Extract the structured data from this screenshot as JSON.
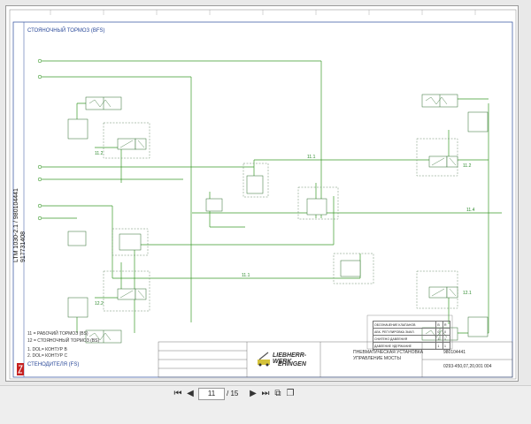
{
  "page_nav": {
    "current": "11",
    "separator": "/",
    "total": "15"
  },
  "sections": {
    "top": "СТОЯНОЧНЫЙ ТОРМОЗ (BFS)",
    "bottom": "СТЕНОДИТЕЛЯ (FS)"
  },
  "side_strip": {
    "model": "LTM 1030-2.1",
    "serial": "917731408",
    "doc": "980104441"
  },
  "notes": {
    "n1": "11 = РАБОЧИЙ ТОРМОЗ (BS)",
    "n2": "12 = СТОЯНОЧНЫЙ ТОРМОЗ (BS)",
    "n3": "1. DOL= КОНТУР В",
    "n4": "2. DOL= КОНТУР С"
  },
  "legend_table": {
    "rows": [
      {
        "label": "ОБОЗНАЧЕНИЕ КЛАПАНОВ",
        "a": "B",
        "b": "R"
      },
      {
        "label": "АБК- РЕГУЛИРОВКА ЗЫКЛ.",
        "a": "0",
        "b": "0"
      },
      {
        "label": "СНИГЕНО ДАВЛЕНИЯ",
        "a": "1",
        "b": "1"
      },
      {
        "label": "ДАВЛЕНИЕ УДЕРЖАНИЕ",
        "a": "1",
        "b": "1"
      }
    ]
  },
  "title_block": {
    "brand_top": "LIEBHERR-WERK",
    "brand_bottom": "EHINGEN",
    "title1": "ПНЕВМАТИЧЕСКАЯ УСТАНОВКА",
    "title2": "УПРАВЛЕНИЕ МОСТЫ",
    "doc_no": "980104441",
    "ref": "0293-450,07,20,001 004"
  },
  "line_labels": {
    "l1": "11.2",
    "l2": "12.2",
    "l3": "11.2",
    "l4": "12.1",
    "l5": "11.1",
    "l6": "11.4",
    "l7": "11.1"
  },
  "colors": {
    "line": "#3a9a2a",
    "dash": "#6a8a6a",
    "frame": "#2b4a9a"
  }
}
